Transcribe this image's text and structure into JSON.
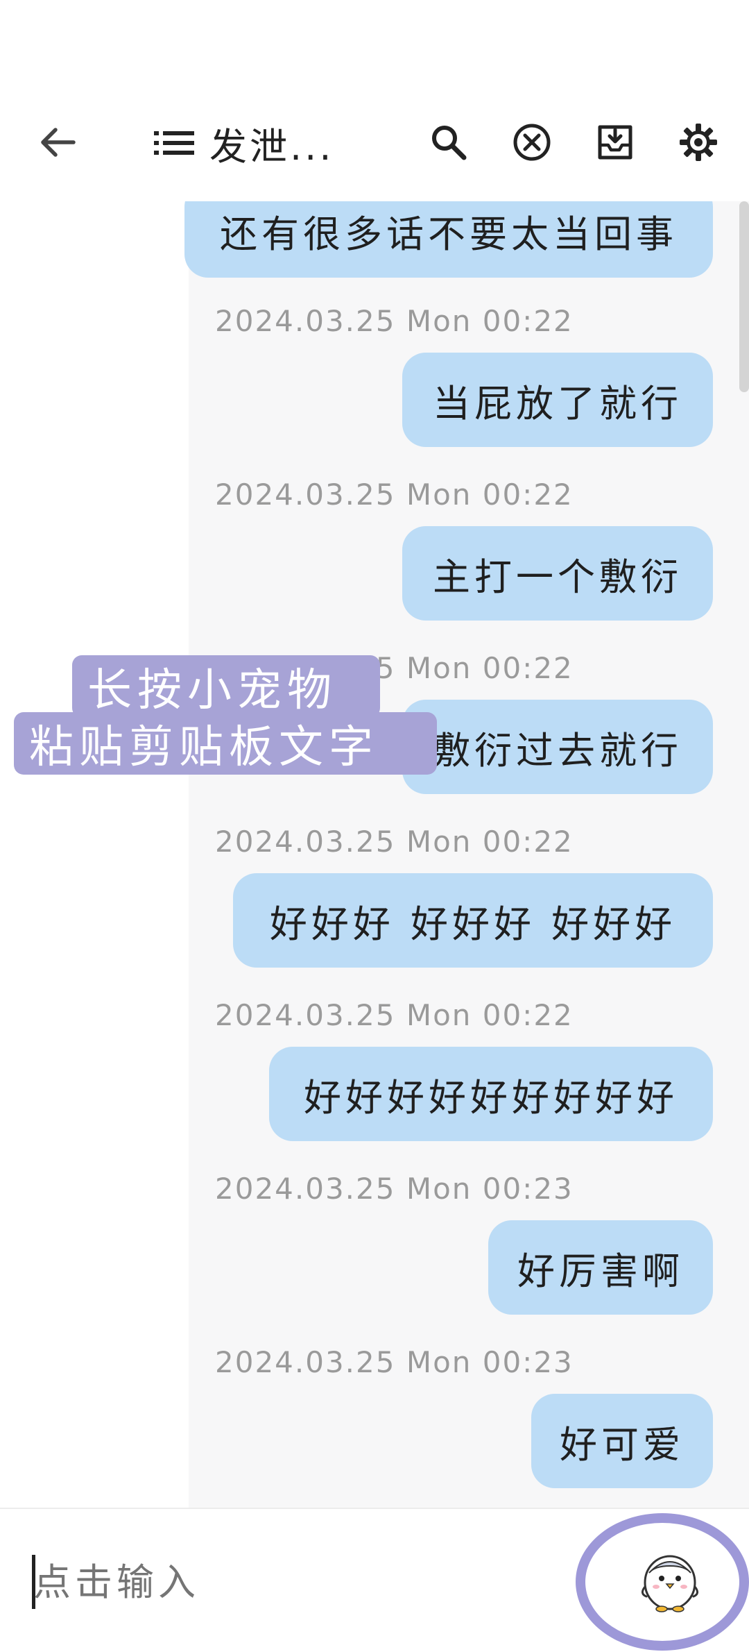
{
  "header": {
    "title": "发泄...",
    "icons": [
      "back-arrow-icon",
      "list-icon",
      "search-icon",
      "close-circle-icon",
      "download-icon",
      "gear-icon"
    ]
  },
  "messages": [
    {
      "timestamp": "",
      "text": "还有很多话不要太当回事"
    },
    {
      "timestamp": "2024.03.25 Mon 00:22",
      "text": "当屁放了就行"
    },
    {
      "timestamp": "2024.03.25 Mon 00:22",
      "text": "主打一个敷衍"
    },
    {
      "timestamp": "2024.03.25 Mon 00:22",
      "text": "敷衍过去就行"
    },
    {
      "timestamp": "2024.03.25 Mon 00:22",
      "text": "好好好 好好好 好好好"
    },
    {
      "timestamp": "2024.03.25 Mon 00:22",
      "text": "好好好好好好好好好"
    },
    {
      "timestamp": "2024.03.25 Mon 00:23",
      "text": "好厉害啊"
    },
    {
      "timestamp": "2024.03.25 Mon 00:23",
      "text": "好可爱"
    }
  ],
  "overlay": {
    "line1": "长按小宠物",
    "line2": "粘贴剪贴板文字"
  },
  "input": {
    "placeholder": "点击输入"
  },
  "colors": {
    "bubble": "#bcdcf6",
    "overlay": "#a7a3d6",
    "circle": "#9d98d8"
  }
}
